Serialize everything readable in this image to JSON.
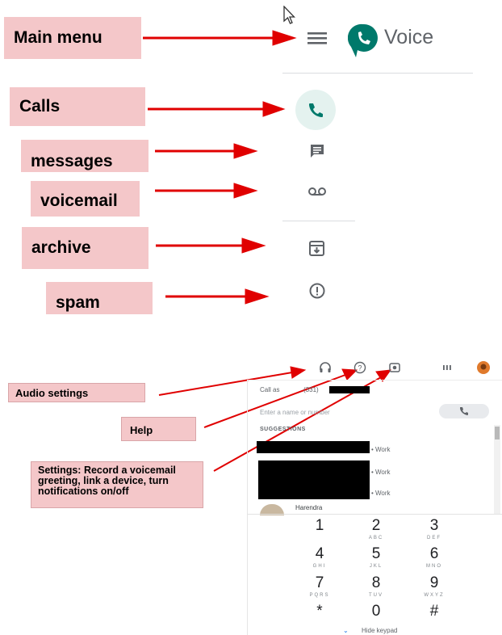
{
  "annotations": {
    "main_menu": "Main menu",
    "calls": "Calls",
    "messages": "messages",
    "voicemail": "voicemail",
    "archive": "archive",
    "spam": "spam",
    "audio_settings": "Audio settings",
    "help": "Help",
    "settings": "Settings: Record a voicemail greeting, link a device, turn notifications on/off"
  },
  "header": {
    "app_title": "Voice",
    "menu_icon": "hamburger-menu-icon",
    "logo_icon": "google-voice-logo-icon"
  },
  "nav": {
    "items": [
      {
        "id": "calls",
        "icon": "phone-icon",
        "active": true
      },
      {
        "id": "messages",
        "icon": "message-icon"
      },
      {
        "id": "voicemail",
        "icon": "voicemail-icon"
      },
      {
        "id": "archive",
        "icon": "archive-icon"
      },
      {
        "id": "spam",
        "icon": "spam-icon"
      }
    ]
  },
  "toolbar": {
    "audio_icon": "headset-icon",
    "help_icon": "help-icon",
    "settings_icon": "settings-icon",
    "apps_icon": "apps-grid-icon",
    "avatar_icon": "account-avatar"
  },
  "dialer": {
    "call_as_label": "Call as",
    "call_as_number": "(331)",
    "input_placeholder": "Enter a name or number",
    "suggestions_heading": "SUGGESTIONS",
    "suggestions": [
      {
        "label": "• Work"
      },
      {
        "label": "• Work"
      },
      {
        "label": "• Work"
      },
      {
        "label": "Harendra"
      }
    ],
    "keys": [
      {
        "digit": "1",
        "letters": ""
      },
      {
        "digit": "2",
        "letters": "ABC"
      },
      {
        "digit": "3",
        "letters": "DEF"
      },
      {
        "digit": "4",
        "letters": "GHI"
      },
      {
        "digit": "5",
        "letters": "JKL"
      },
      {
        "digit": "6",
        "letters": "MNO"
      },
      {
        "digit": "7",
        "letters": "PQRS"
      },
      {
        "digit": "8",
        "letters": "TUV"
      },
      {
        "digit": "9",
        "letters": "WXYZ"
      },
      {
        "digit": "*",
        "letters": ""
      },
      {
        "digit": "0",
        "letters": ""
      },
      {
        "digit": "#",
        "letters": ""
      }
    ],
    "hide_keypad": "Hide keypad"
  },
  "colors": {
    "accent": "#00796b",
    "annotation_bg": "#f4c7c9",
    "arrow": "#e00000"
  }
}
